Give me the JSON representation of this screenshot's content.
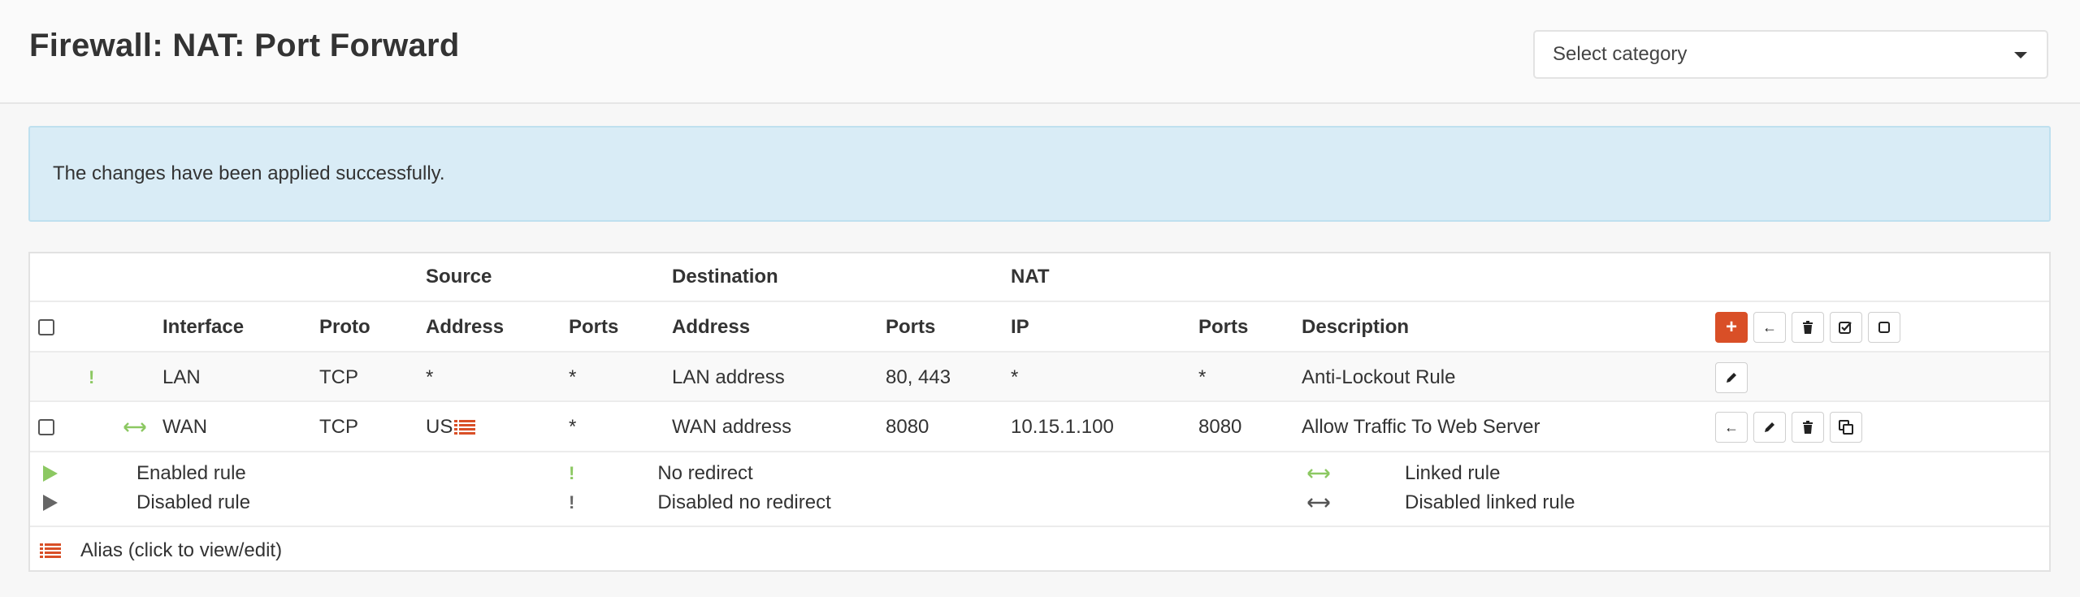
{
  "header": {
    "title": "Firewall: NAT: Port Forward",
    "category_select": {
      "value": "Select category"
    }
  },
  "alert": {
    "message": "The changes have been applied successfully."
  },
  "table": {
    "group_headers": {
      "source": "Source",
      "destination": "Destination",
      "nat": "NAT"
    },
    "columns": {
      "interface": "Interface",
      "proto": "Proto",
      "src_address": "Address",
      "src_ports": "Ports",
      "dst_address": "Address",
      "dst_ports": "Ports",
      "nat_ip": "IP",
      "nat_ports": "Ports",
      "description": "Description"
    },
    "rows": [
      {
        "status_icon": "no-redirect-icon",
        "interface": "LAN",
        "proto": "TCP",
        "src_address": "*",
        "src_ports": "*",
        "dst_address": "LAN address",
        "dst_ports": "80, 443",
        "nat_ip": "*",
        "nat_ports": "*",
        "description": "Anti-Lockout Rule",
        "actions": [
          "edit"
        ]
      },
      {
        "status_icon": "linked-rule-icon",
        "interface": "WAN",
        "proto": "TCP",
        "src_address": "US",
        "src_alias_icon": "alias-list-icon",
        "src_ports": "*",
        "dst_address": "WAN address",
        "dst_ports": "8080",
        "nat_ip": "10.15.1.100",
        "nat_ports": "8080",
        "description": "Allow Traffic To Web Server",
        "actions": [
          "move",
          "edit",
          "delete",
          "clone"
        ]
      }
    ],
    "header_actions": [
      "add",
      "move",
      "delete",
      "enable",
      "disable"
    ]
  },
  "legend": {
    "enabled_rule": "Enabled rule",
    "disabled_rule": "Disabled rule",
    "no_redirect": "No redirect",
    "disabled_no_redirect": "Disabled no redirect",
    "linked_rule": "Linked rule",
    "disabled_linked_rule": "Disabled linked rule",
    "alias": "Alias (click to view/edit)"
  },
  "colors": {
    "accent": "#d94f27",
    "enabled_green": "#8cc862",
    "disabled_gray": "#666666",
    "alert_bg": "#d9ecf6"
  }
}
